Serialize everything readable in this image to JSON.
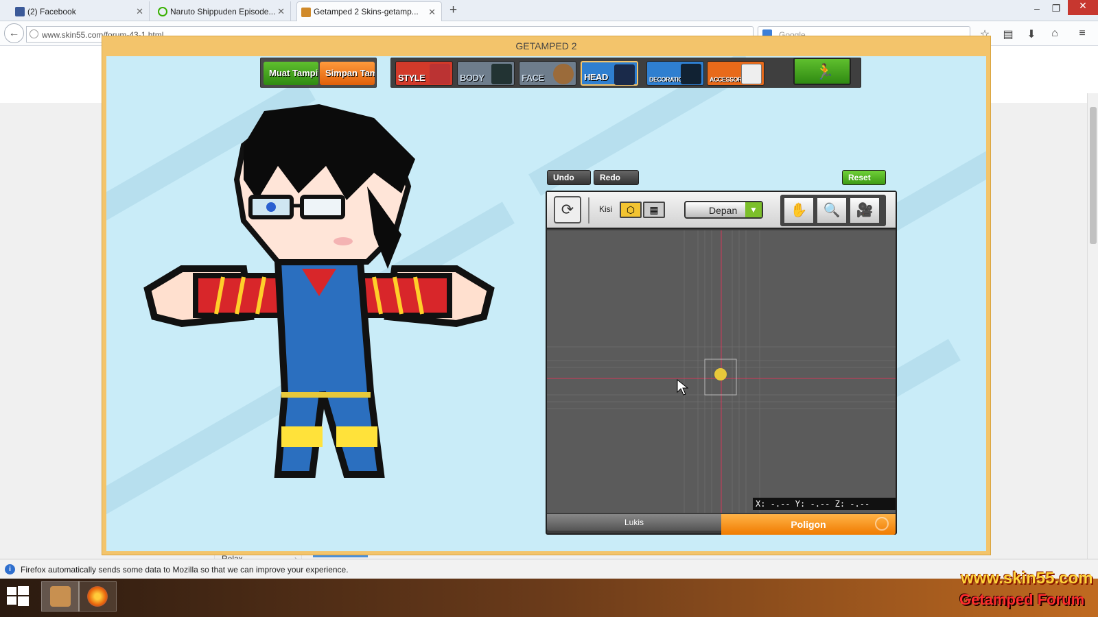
{
  "browser": {
    "tabs": [
      {
        "title": "(2) Facebook",
        "favicon": "facebook-icon",
        "color": "#3b5998"
      },
      {
        "title": "Naruto Shippuden Episode...",
        "favicon": "loading-icon",
        "color": "#38b000"
      },
      {
        "title": "Getamped 2 Skins-getamp...",
        "favicon": "site-icon",
        "color": "#d08a2a"
      }
    ],
    "url": "www.skin55.com/forum-43-1.html",
    "search_placeholder": "Google"
  },
  "page": {
    "sidebar_item": "Relax"
  },
  "game": {
    "title": "GETAMPED 2",
    "toolbar": {
      "load_label": "Muat Tampilan",
      "save_label": "Simpan Tampilan",
      "categories": [
        {
          "label": "STYLE",
          "color": "#ffffff",
          "bg": "#d23a2a"
        },
        {
          "label": "BODY",
          "color": "#c7d7e6",
          "bg": "#6b8199"
        },
        {
          "label": "FACE",
          "color": "#c7d7e6",
          "bg": "#6b8199"
        },
        {
          "label": "HEAD",
          "color": "#ffffff",
          "bg": "#2f7fd0"
        },
        {
          "label": "DECORATION",
          "color": "#ffffff",
          "bg": "#2f7fd0"
        },
        {
          "label": "ACCESSORY",
          "color": "#ffffff",
          "bg": "#e86a1a"
        }
      ],
      "exit_icon": "exit-icon"
    },
    "editor": {
      "undo_label": "Undo",
      "redo_label": "Redo",
      "reset_label": "Reset",
      "grid_label": "Kisi",
      "view_value": "Depan",
      "coord_readout": "X: -.-- Y: -.-- Z: -.--",
      "tab_paint": "Lukis",
      "tab_polygon": "Poligon",
      "tools": [
        "hand-icon",
        "zoom-icon",
        "camera-icon"
      ]
    }
  },
  "notification": {
    "text": "Firefox automatically sends some data to Mozilla so that we can improve your experience."
  },
  "watermark": {
    "line1": "www.skin55.com",
    "line2": "Getamped Forum"
  }
}
